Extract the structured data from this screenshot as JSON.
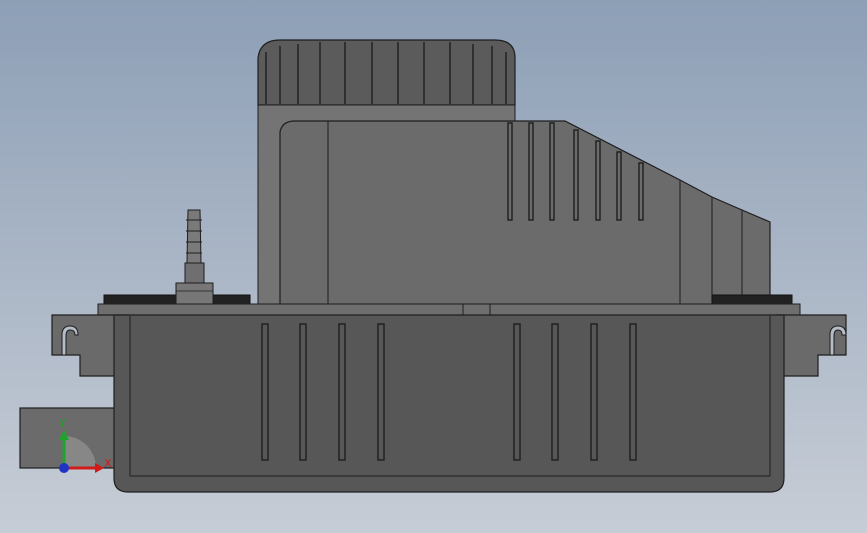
{
  "axes": {
    "x_label": "X",
    "y_label": "Y"
  },
  "colors": {
    "background_top": "#8d9fb6",
    "background_bottom": "#c7cdd6",
    "body_gray": "#575757",
    "upper_gray": "#6a6a6a",
    "edge": "#1e1e1e",
    "gasket": "#222222",
    "axis_x": "#d11a1a",
    "axis_y": "#1fa32d",
    "axis_z": "#1f33c4"
  }
}
